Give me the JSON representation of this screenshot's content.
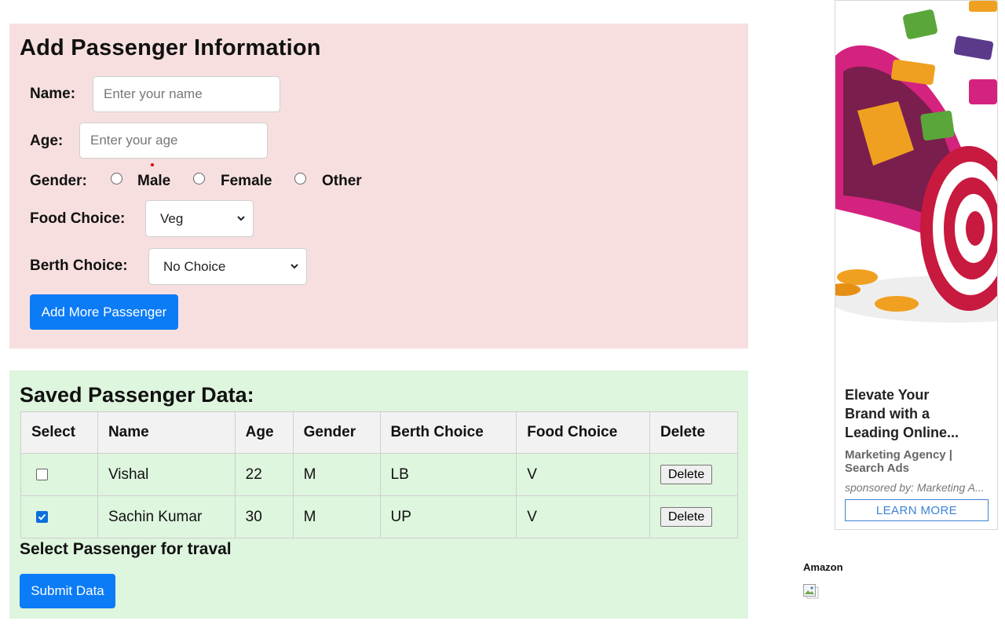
{
  "add_form": {
    "title": "Add Passenger Information",
    "name_label": "Name:",
    "name_placeholder": "Enter your name",
    "name_value": "",
    "age_label": "Age:",
    "age_placeholder": "Enter your age",
    "age_value": "",
    "gender_label": "Gender:",
    "gender_options": [
      "Male",
      "Female",
      "Other"
    ],
    "gender_selected": null,
    "food_label": "Food Choice:",
    "food_selected": "Veg",
    "berth_label": "Berth Choice:",
    "berth_selected": "No Choice",
    "add_button": "Add More Passenger"
  },
  "saved": {
    "title": "Saved Passenger Data:",
    "columns": [
      "Select",
      "Name",
      "Age",
      "Gender",
      "Berth Choice",
      "Food Choice",
      "Delete"
    ],
    "rows": [
      {
        "selected": false,
        "name": "Vishal",
        "age": "22",
        "gender": "M",
        "berth": "LB",
        "food": "V",
        "delete_label": "Delete"
      },
      {
        "selected": true,
        "name": "Sachin Kumar",
        "age": "30",
        "gender": "M",
        "berth": "UP",
        "food": "V",
        "delete_label": "Delete"
      }
    ],
    "select_hint": "Select Passenger for traval",
    "submit_button": "Submit Data"
  },
  "ad": {
    "headline": "Elevate Your\nBrand with a\nLeading Online...",
    "advertiser": "Marketing Agency |\nSearch Ads",
    "sponsor": "sponsored by: Marketing A...",
    "cta": "LEARN MORE"
  },
  "amazon_widget": {
    "label": "Amazon"
  },
  "colors": {
    "form_bg": "#f7dfdf",
    "data_bg": "#def5de",
    "primary": "#0b7bf6",
    "ad_cta": "#3b83d4"
  }
}
